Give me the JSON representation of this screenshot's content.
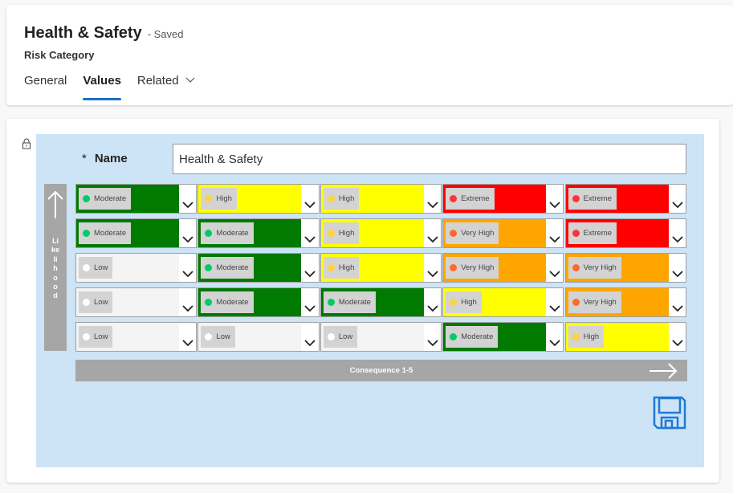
{
  "header": {
    "title": "Health & Safety",
    "status": "- Saved",
    "entity": "Risk Category",
    "tabs": [
      {
        "label": "General",
        "active": false
      },
      {
        "label": "Values",
        "active": true
      },
      {
        "label": "Related",
        "active": false,
        "has_dropdown": true
      }
    ]
  },
  "form": {
    "name_required_marker": "*",
    "name_label": "Name",
    "name_value": "Health & Safety",
    "likelihood_label": "Likelihood",
    "consequence_label": "Consequence 1-5",
    "save_icon": "save-icon",
    "lock_icon": "lock-icon"
  },
  "levels": {
    "Low": {
      "fill": "#f4f4f4",
      "dot": "#ffffff"
    },
    "Moderate": {
      "fill": "#007a00",
      "dot": "#00cc66"
    },
    "High": {
      "fill": "#ffff00",
      "dot": "#ffd23f"
    },
    "Very High": {
      "fill": "#ffa500",
      "dot": "#ff6a2b"
    },
    "Extreme": {
      "fill": "#ff0000",
      "dot": "#ff3333"
    }
  },
  "matrix": [
    [
      "Moderate",
      "High",
      "High",
      "Extreme",
      "Extreme"
    ],
    [
      "Moderate",
      "Moderate",
      "High",
      "Very High",
      "Extreme"
    ],
    [
      "Low",
      "Moderate",
      "High",
      "Very High",
      "Very High"
    ],
    [
      "Low",
      "Moderate",
      "Moderate",
      "High",
      "Very High"
    ],
    [
      "Low",
      "Low",
      "Low",
      "Moderate",
      "High"
    ]
  ]
}
